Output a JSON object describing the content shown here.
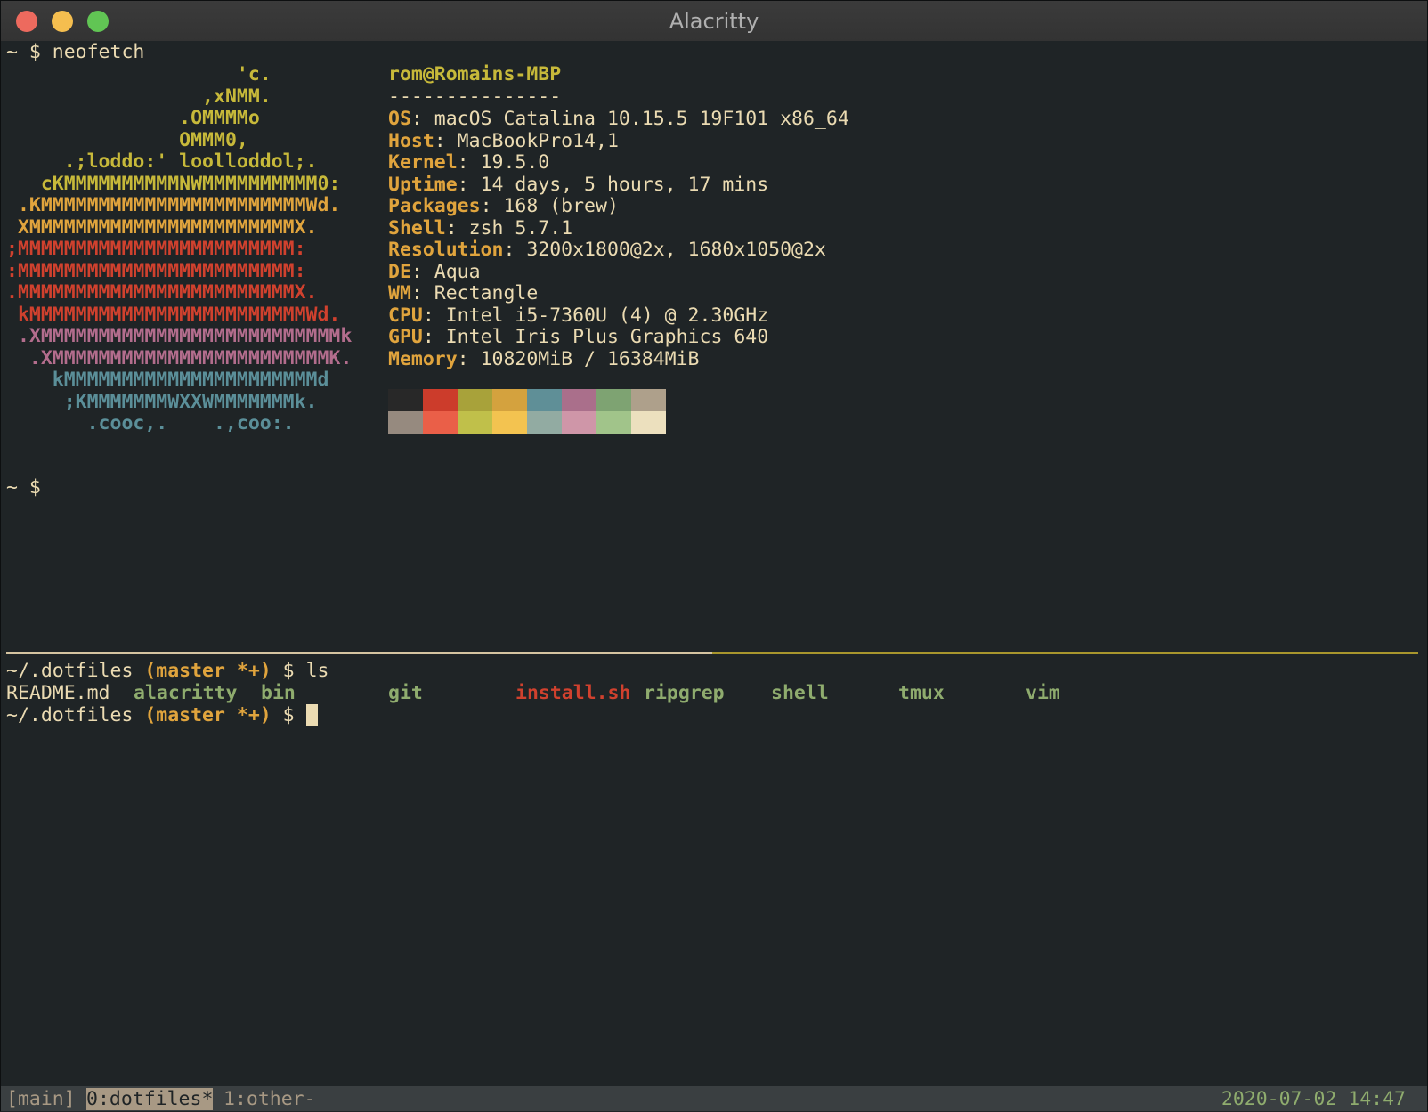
{
  "window": {
    "title": "Alacritty"
  },
  "prompt": {
    "home": "~ $ ",
    "command": "neofetch",
    "empty": "~ $"
  },
  "logo": [
    {
      "text": "                    'c.",
      "color": "#c7b93a"
    },
    {
      "text": "                 ,xNMM.",
      "color": "#c7b93a"
    },
    {
      "text": "               .OMMMMo",
      "color": "#c7b93a"
    },
    {
      "text": "               OMMM0,",
      "color": "#c7b93a"
    },
    {
      "text": "     .;loddo:' loolloddol;.",
      "color": "#c7b93a"
    },
    {
      "text": "   cKMMMMMMMMMMNWMMMMMMMMMM0:",
      "color": "#c7b93a"
    },
    {
      "text": " .KMMMMMMMMMMMMMMMMMMMMMMMWd.",
      "color": "#e0a43d"
    },
    {
      "text": " XMMMMMMMMMMMMMMMMMMMMMMMX.",
      "color": "#e0a43d"
    },
    {
      "text": ";MMMMMMMMMMMMMMMMMMMMMMMM:",
      "color": "#d0412e"
    },
    {
      "text": ":MMMMMMMMMMMMMMMMMMMMMMMM:",
      "color": "#d0412e"
    },
    {
      "text": ".MMMMMMMMMMMMMMMMMMMMMMMMX.",
      "color": "#d0412e"
    },
    {
      "text": " kMMMMMMMMMMMMMMMMMMMMMMMMWd.",
      "color": "#d0412e"
    },
    {
      "text": " .XMMMMMMMMMMMMMMMMMMMMMMMMMMk",
      "color": "#b36d8d"
    },
    {
      "text": "  .XMMMMMMMMMMMMMMMMMMMMMMMMK.",
      "color": "#b36d8d"
    },
    {
      "text": "    kMMMMMMMMMMMMMMMMMMMMMMd",
      "color": "#5b8f99"
    },
    {
      "text": "     ;KMMMMMMMWXXWMMMMMMMk.",
      "color": "#5b8f99"
    },
    {
      "text": "       .cooc,.    .,coo:.",
      "color": "#5b8f99"
    }
  ],
  "info": {
    "user": "rom@Romains-MBP",
    "separator": "---------------",
    "fields": [
      {
        "key": "OS",
        "value": ": macOS Catalina 10.15.5 19F101 x86_64"
      },
      {
        "key": "Host",
        "value": ": MacBookPro14,1"
      },
      {
        "key": "Kernel",
        "value": ": 19.5.0"
      },
      {
        "key": "Uptime",
        "value": ": 14 days, 5 hours, 17 mins"
      },
      {
        "key": "Packages",
        "value": ": 168 (brew)"
      },
      {
        "key": "Shell",
        "value": ": zsh 5.7.1"
      },
      {
        "key": "Resolution",
        "value": ": 3200x1800@2x, 1680x1050@2x"
      },
      {
        "key": "DE",
        "value": ": Aqua"
      },
      {
        "key": "WM",
        "value": ": Rectangle"
      },
      {
        "key": "CPU",
        "value": ": Intel i5-7360U (4) @ 2.30GHz"
      },
      {
        "key": "GPU",
        "value": ": Intel Iris Plus Graphics 640"
      },
      {
        "key": "Memory",
        "value": ": 10820MiB / 16384MiB"
      }
    ]
  },
  "palette": {
    "row1": [
      "#282828",
      "#cc3c2b",
      "#a8a23a",
      "#d4a23e",
      "#5f8f97",
      "#aa6f8b",
      "#7ea372",
      "#aea08b"
    ],
    "row2": [
      "#968a7f",
      "#ea5f48",
      "#c0c04a",
      "#f3c350",
      "#92aba2",
      "#cf96a8",
      "#a1c48a",
      "#ece0be"
    ]
  },
  "pane2": {
    "dir": "~/.dotfiles",
    "branch": " (master *+)",
    "prompt_tail": " $ ",
    "command": "ls",
    "files": [
      {
        "name": "README.md",
        "color": "#ebdbb2"
      },
      {
        "name": "alacritty",
        "color": "#8fac6e"
      },
      {
        "name": "bin",
        "color": "#8fac6e"
      },
      {
        "name": "git",
        "color": "#8fac6e"
      },
      {
        "name": "install.sh",
        "color": "#d0412e"
      },
      {
        "name": "ripgrep",
        "color": "#8fac6e"
      },
      {
        "name": "shell",
        "color": "#8fac6e"
      },
      {
        "name": "tmux",
        "color": "#8fac6e"
      },
      {
        "name": "vim",
        "color": "#8fac6e"
      }
    ]
  },
  "statusbar": {
    "session": "[main]",
    "active_window": "0:dotfiles*",
    "other_window": "1:other-",
    "clock": "2020-07-02 14:47"
  }
}
